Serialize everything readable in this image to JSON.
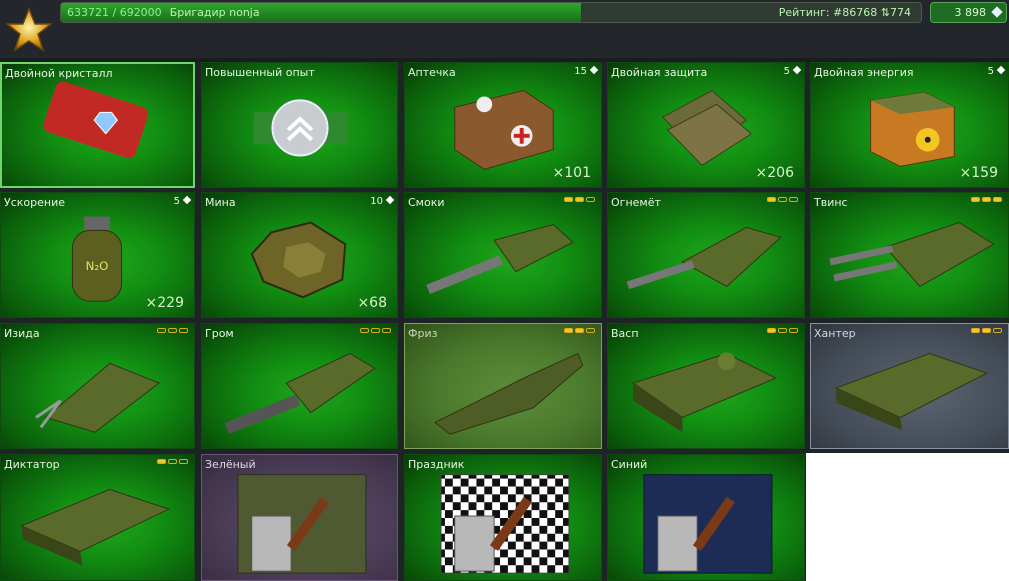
{
  "top": {
    "xp": "633721 / 692000",
    "player": "Бригадир nonja",
    "xp_progress": 0.605,
    "rating": "Рейтинг: #86768",
    "rating_delta": "774",
    "crystals": "3 898"
  },
  "items": [
    {
      "name": "Двойной кристалл",
      "count": "",
      "qty": ""
    },
    {
      "name": "Повышенный опыт",
      "count": "",
      "qty": ""
    },
    {
      "name": "Аптечка",
      "count": "15",
      "qty": "×101"
    },
    {
      "name": "Двойная защита",
      "count": "5",
      "qty": "×206"
    },
    {
      "name": "Двойная энергия",
      "count": "5",
      "qty": "×159"
    },
    {
      "name": "Ускорение",
      "count": "5",
      "qty": "×229"
    },
    {
      "name": "Мина",
      "count": "10",
      "qty": "×68"
    },
    {
      "name": "Смоки",
      "level": 2
    },
    {
      "name": "Огнемёт",
      "level": 1
    },
    {
      "name": "Твинс",
      "level": 3
    },
    {
      "name": "Изида",
      "level": 0
    },
    {
      "name": "Гром",
      "level": 0
    },
    {
      "name": "Фриз",
      "level": 2
    },
    {
      "name": "Васп",
      "level": 1
    },
    {
      "name": "Хантер",
      "level": 2
    },
    {
      "name": "Диктатор",
      "level": 1
    },
    {
      "name": "Зелёный"
    },
    {
      "name": "Праздник"
    },
    {
      "name": "Синий"
    }
  ]
}
